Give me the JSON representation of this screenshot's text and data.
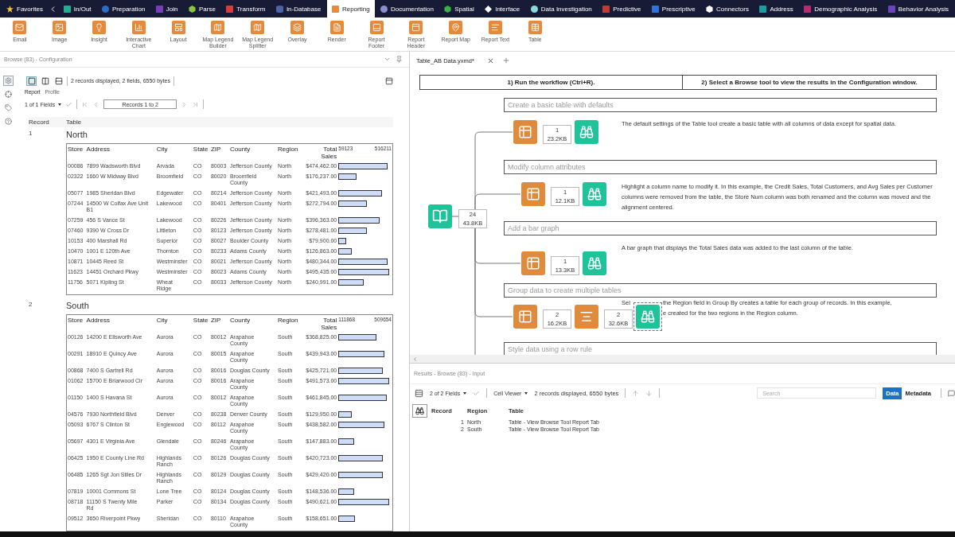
{
  "categories": [
    {
      "label": "Favorites",
      "kind": "star",
      "color": "#f2c230",
      "selected": false
    },
    {
      "label": "In/Out",
      "kind": "square",
      "color": "#1fae8f",
      "selected": false
    },
    {
      "label": "Preparation",
      "kind": "circle",
      "color": "#2d6cc0",
      "selected": false
    },
    {
      "label": "Join",
      "kind": "square",
      "color": "#7a3db8",
      "selected": false
    },
    {
      "label": "Parse",
      "kind": "hexagon",
      "color": "#86c440",
      "selected": false
    },
    {
      "label": "Transform",
      "kind": "square",
      "color": "#d93a3a",
      "selected": false
    },
    {
      "label": "In-Database",
      "kind": "cylinder",
      "color": "#4b64a8",
      "selected": false
    },
    {
      "label": "Reporting",
      "kind": "square",
      "color": "#e8883a",
      "selected": true
    },
    {
      "label": "Documentation",
      "kind": "circle",
      "color": "#8a8fd0",
      "selected": false
    },
    {
      "label": "Spatial",
      "kind": "hexagon",
      "color": "#3bb043",
      "selected": false
    },
    {
      "label": "Interface",
      "kind": "diamond",
      "color": "#ffffff",
      "selected": false
    },
    {
      "label": "Data Investigation",
      "kind": "circle",
      "color": "#8fd8d8",
      "selected": false
    },
    {
      "label": "Predictive",
      "kind": "square",
      "color": "#c43a30",
      "selected": false
    },
    {
      "label": "Prescriptive",
      "kind": "square",
      "color": "#2f73d8",
      "selected": false
    },
    {
      "label": "Connectors",
      "kind": "hexagon",
      "color": "#ffffff",
      "selected": false
    },
    {
      "label": "Address",
      "kind": "square",
      "color": "#1a9e9e",
      "selected": false
    },
    {
      "label": "Demographic Analysis",
      "kind": "square",
      "color": "#b82a70",
      "selected": false
    },
    {
      "label": "Behavior Analysis",
      "kind": "square",
      "color": "#6a44b8",
      "selected": false
    }
  ],
  "tools": [
    "Email",
    "Image",
    "Insight",
    "Interactive\nChart",
    "Layout",
    "Map Legend\nBuilder",
    "Map Legend\nSplitter",
    "Overlay",
    "Render",
    "Report\nFooter",
    "Report\nHeader",
    "Report Map",
    "Report Text",
    "Table"
  ],
  "configuration": {
    "title": "Browse (83) - Configuration",
    "side_tools": [
      {
        "kind": "gear",
        "selected": true
      },
      {
        "kind": "target",
        "selected": false
      },
      {
        "kind": "tag",
        "selected": false
      },
      {
        "kind": "help",
        "selected": false
      }
    ],
    "layouts": [
      {
        "kind": "single",
        "selected": true
      },
      {
        "kind": "columns",
        "selected": false
      },
      {
        "kind": "rows",
        "selected": false
      }
    ],
    "status": "2 records displayed, 2 fields, 6550 bytes",
    "tabs": [
      {
        "label": "Report",
        "selected": true
      },
      {
        "label": "Profile",
        "selected": false
      }
    ],
    "fields": "1 of 1 Fields",
    "records": "Records 1 to 2",
    "columns": [
      "Record",
      "Table"
    ],
    "groups": [
      {
        "record": "1",
        "title": "North",
        "columns": [
          "Store",
          "Address",
          "City",
          "State",
          "ZIP",
          "County",
          "Region",
          "Total\nSales"
        ],
        "axis": [
          "59123",
          "516211"
        ],
        "rows": [
          {
            "cells": [
              "00086",
              "7899 Wadsworth Blvd",
              "Arvada",
              "CO",
              "80003",
              "Jefferson County",
              "North",
              "$474,462.00"
            ],
            "level": 0.92
          },
          {
            "cells": [
              "02322",
              "1660 W Midway Blvd",
              "Broomfield",
              "CO",
              "80020",
              "Broomfield\nCounty",
              "North",
              "$176,237.00"
            ],
            "level": 0.34
          },
          {
            "cells": [
              "05077",
              "1985 Sheridan Blvd",
              "Edgewater",
              "CO",
              "80214",
              "Jefferson County",
              "North",
              "$421,493.00"
            ],
            "level": 0.82
          },
          {
            "cells": [
              "07244",
              "14500 W Colfax Ave Unit\nB1",
              "Lakewood",
              "CO",
              "80401",
              "Jefferson County",
              "North",
              "$272,794.00"
            ],
            "level": 0.53
          },
          {
            "cells": [
              "07259",
              "456 S Vance St",
              "Lakewood",
              "CO",
              "80226",
              "Jefferson County",
              "North",
              "$396,363.00"
            ],
            "level": 0.77
          },
          {
            "cells": [
              "07460",
              "9390 W Cross Dr",
              "Littleton",
              "CO",
              "80123",
              "Jefferson County",
              "North",
              "$278,481.00"
            ],
            "level": 0.54
          },
          {
            "cells": [
              "10153",
              "400 Marshall Rd",
              "Superior",
              "CO",
              "80027",
              "Boulder County",
              "North",
              "$79,900.00"
            ],
            "level": 0.15
          },
          {
            "cells": [
              "10470",
              "1001 E 120th Ave",
              "Thornton",
              "CO",
              "80233",
              "Adams County",
              "North",
              "$126,863.00"
            ],
            "level": 0.25
          },
          {
            "cells": [
              "10871",
              "10445 Reed St",
              "Westminster",
              "CO",
              "80021",
              "Jefferson County",
              "North",
              "$480,344.00"
            ],
            "level": 0.93
          },
          {
            "cells": [
              "11623",
              "14451 Orchard Pkwy",
              "Westminster",
              "CO",
              "80023",
              "Adams County",
              "North",
              "$495,435.00"
            ],
            "level": 0.96
          },
          {
            "cells": [
              "11756",
              "5071 Kipling St",
              "Wheat\nRidge",
              "CO",
              "80033",
              "Jefferson County",
              "North",
              "$240,991.00"
            ],
            "level": 0.47
          }
        ]
      },
      {
        "record": "2",
        "title": "South",
        "columns": [
          "Store",
          "Address",
          "City",
          "State",
          "ZIP",
          "County",
          "Region",
          "Total\nSales"
        ],
        "axis": [
          "111868",
          "509654"
        ],
        "rows": [
          {
            "cells": [
              "00126",
              "14200 E Ellsworth Ave",
              "Aurora",
              "CO",
              "80012",
              "Arapahoe\nCounty",
              "South",
              "$368,825.00"
            ],
            "level": 0.72
          },
          {
            "cells": [
              "00291",
              "18910 E Quincy Ave",
              "Aurora",
              "CO",
              "80015",
              "Arapahoe\nCounty",
              "South",
              "$439,943.00"
            ],
            "level": 0.86
          },
          {
            "cells": [
              "00868",
              "7400 S Gartrell Rd",
              "Aurora",
              "CO",
              "80016",
              "Douglas County",
              "South",
              "$425,721.00"
            ],
            "level": 0.84
          },
          {
            "cells": [
              "01062",
              "15700 E Briarwood Cir",
              "Aurora",
              "CO",
              "80016",
              "Arapahoe\nCounty",
              "South",
              "$491,573.00"
            ],
            "level": 0.96
          },
          {
            "cells": [
              "01150",
              "1400 S Havana St",
              "Aurora",
              "CO",
              "80012",
              "Arapahoe\nCounty",
              "South",
              "$461,845.00"
            ],
            "level": 0.91
          },
          {
            "cells": [
              "04576",
              "7930 Northfield Blvd",
              "Denver",
              "CO",
              "80238",
              "Denver County",
              "South",
              "$129,950.00"
            ],
            "level": 0.25
          },
          {
            "cells": [
              "05093",
              "6767 S Clinton St",
              "Englewood",
              "CO",
              "80112",
              "Arapahoe\nCounty",
              "South",
              "$438,582.00"
            ],
            "level": 0.86
          },
          {
            "cells": [
              "05697",
              "4301 E Virginia Ave",
              "Glendale",
              "CO",
              "80246",
              "Arapahoe\nCounty",
              "South",
              "$147,883.00"
            ],
            "level": 0.29
          },
          {
            "cells": [
              "06425",
              "1950 E County Line Rd",
              "Highlands\nRanch",
              "CO",
              "80126",
              "Douglas County",
              "South",
              "$420,723.00"
            ],
            "level": 0.83
          },
          {
            "cells": [
              "06485",
              "1265 Sgt Jon Stiles Dr",
              "Highlands\nRanch",
              "CO",
              "80129",
              "Douglas County",
              "South",
              "$429,420.00"
            ],
            "level": 0.84
          },
          {
            "cells": [
              "07819",
              "10001 Commons St",
              "Lone Tree",
              "CO",
              "80124",
              "Douglas County",
              "South",
              "$148,536.00"
            ],
            "level": 0.29
          },
          {
            "cells": [
              "08718",
              "11150 S Twenty Mile\nRd",
              "Parker",
              "CO",
              "80134",
              "Douglas County",
              "South",
              "$490,621.00"
            ],
            "level": 0.96
          },
          {
            "cells": [
              "09512",
              "3650 Riverpoint Pkwy",
              "Sheridan",
              "CO",
              "80110",
              "Arapahoe\nCounty",
              "South",
              "$158,651.00"
            ],
            "level": 0.31
          }
        ]
      }
    ]
  },
  "workflow": {
    "tab": {
      "label": "Table_AB Data.yxmd*",
      "selected": true
    },
    "steps": [
      "1) Run the workflow (Ctrl+R).",
      "2) Select a Browse tool to view the results in the Configuration window."
    ],
    "input": {
      "count": "24",
      "size": "43.8KB"
    },
    "sections": [
      {
        "title": "Create a basic table with defaults",
        "description": "The default settings of the Table tool create a basic table with all columns of data except for spatial data.",
        "outputs": [
          {
            "kind": "table",
            "count": "1",
            "size": "23.2KB"
          },
          {
            "kind": "browse",
            "selected": false
          }
        ]
      },
      {
        "title": "Modify column attributes",
        "description": "Highlight a column name to modify it. In this example, the Credit Sales, Total Customers, and Avg Sales per Customer columns were removed from the table, the Store Num column was both renamed and the column was moved and the alignment centered.",
        "outputs": [
          {
            "kind": "table",
            "count": "1",
            "size": "12.1KB"
          },
          {
            "kind": "browse",
            "selected": false
          }
        ]
      },
      {
        "title": "Add a bar graph",
        "description": "A bar graph that displays the Total Sales data was added to the last column of the table.",
        "outputs": [
          {
            "kind": "table",
            "count": "1",
            "size": "13.3KB"
          },
          {
            "kind": "browse",
            "selected": false
          }
        ]
      },
      {
        "title": "Group data to create multiple tables",
        "fragments": [
          "Sel",
          "the Region field in Group By creates a table for each group of records. In this example,",
          "e created for the two regions in the Region column."
        ],
        "outputs": [
          {
            "kind": "table",
            "count": "2",
            "size": "16.2KB"
          },
          {
            "kind": "text",
            "count": "2",
            "size": "32.6KB"
          },
          {
            "kind": "browse",
            "selected": true
          }
        ]
      },
      {
        "title": "Style data using a row rule"
      }
    ]
  },
  "results": {
    "title": "Results - Browse (83) - Input",
    "fields": "2 of 2 Fields",
    "viewer": "Cell Viewer",
    "status": "2 records displayed, 6550 bytes",
    "search_placeholder": "Search",
    "views": [
      {
        "label": "Data",
        "selected": true
      },
      {
        "label": "Metadata",
        "selected": false
      }
    ],
    "columns": [
      "Record",
      "Region",
      "Table"
    ],
    "rows": [
      {
        "record": "1",
        "region": "North",
        "table": "Table - View Browse Tool Report Tab"
      },
      {
        "record": "2",
        "region": "South",
        "table": "Table - View Browse Tool Report Tab"
      }
    ]
  }
}
